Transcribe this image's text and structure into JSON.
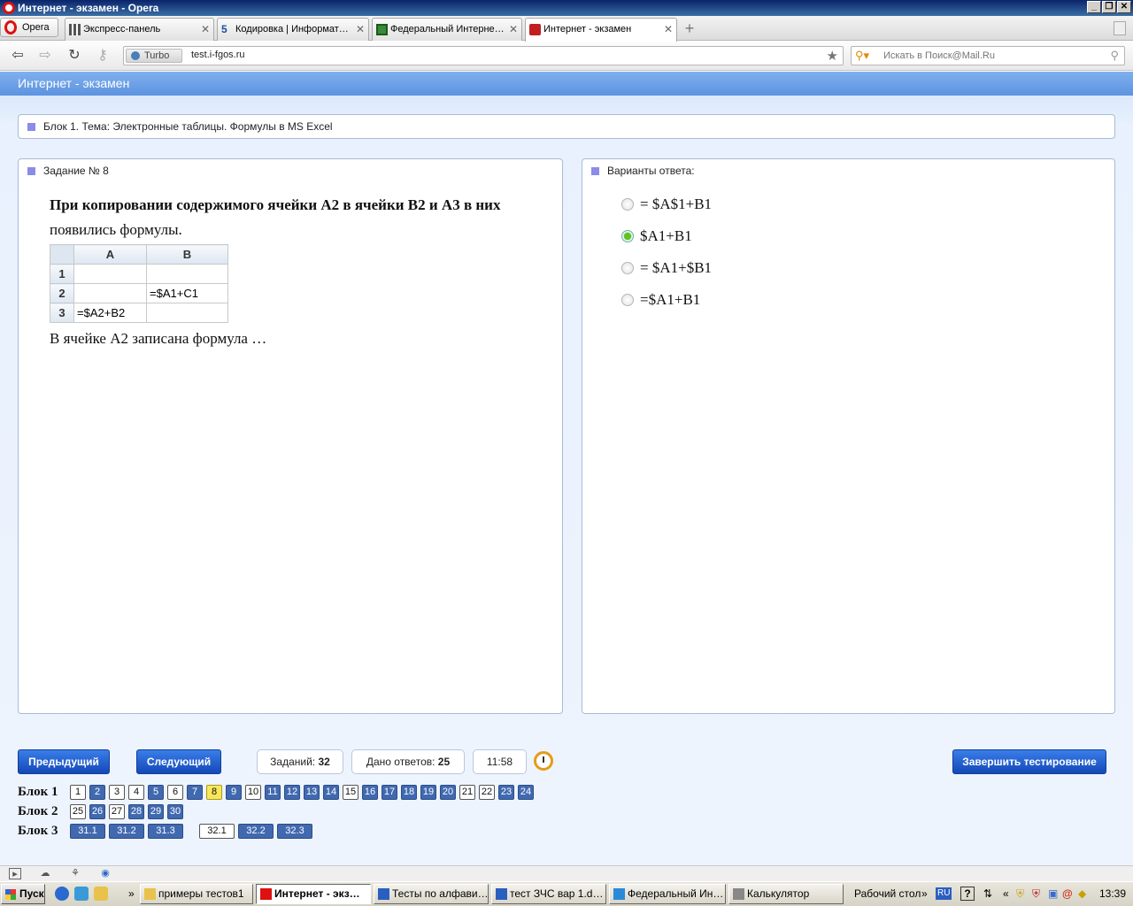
{
  "window": {
    "title": "Интернет - экзамен - Opera"
  },
  "tabs": {
    "opera_menu": "Opera",
    "items": [
      {
        "label": "Экспресс-панель"
      },
      {
        "label": "Кодировка | Информат…"
      },
      {
        "label": "Федеральный Интерне…"
      },
      {
        "label": "Интернет - экзамен"
      }
    ]
  },
  "nav": {
    "turbo_label": "Turbo",
    "url": "test.i-fgos.ru",
    "search_placeholder": "Искать в Поиск@Mail.Ru"
  },
  "page": {
    "header": "Интернет - экзамен",
    "block_title": "Блок 1. Тема: Электронные таблицы. Формулы в MS Excel",
    "task": {
      "title": "Задание № 8",
      "text_line1": "При копировании содержимого ячейки A2 в ячейки B2 и A3 в них",
      "text_line2": "появились формулы.",
      "table": {
        "columns": [
          "A",
          "B"
        ],
        "rows": [
          {
            "num": "1",
            "a": "",
            "b": ""
          },
          {
            "num": "2",
            "a": "",
            "b": "=$A1+C1"
          },
          {
            "num": "3",
            "a": "=$A2+B2",
            "b": ""
          }
        ]
      },
      "text_after": "В ячейке A2 записана формула …"
    },
    "answers": {
      "title": "Варианты ответа:",
      "options": [
        {
          "label": "= $A$1+B1",
          "selected": false
        },
        {
          "label": "$A1+B1",
          "selected": true
        },
        {
          "label": "= $A1+$B1",
          "selected": false
        },
        {
          "label": "=$A1+B1",
          "selected": false
        }
      ]
    },
    "controls": {
      "prev": "Предыдущий",
      "next": "Следующий",
      "tasks_label": "Заданий:",
      "tasks_value": "32",
      "answers_label": "Дано ответов:",
      "answers_value": "25",
      "timer": "11:58",
      "finish": "Завершить тестирование"
    },
    "blocks": [
      {
        "label": "Блок 1",
        "items": [
          {
            "n": "1",
            "s": "w"
          },
          {
            "n": "2",
            "s": "b"
          },
          {
            "n": "3",
            "s": "w"
          },
          {
            "n": "4",
            "s": "w"
          },
          {
            "n": "5",
            "s": "b"
          },
          {
            "n": "6",
            "s": "w"
          },
          {
            "n": "7",
            "s": "b"
          },
          {
            "n": "8",
            "s": "y"
          },
          {
            "n": "9",
            "s": "b"
          },
          {
            "n": "10",
            "s": "w"
          },
          {
            "n": "11",
            "s": "b"
          },
          {
            "n": "12",
            "s": "b"
          },
          {
            "n": "13",
            "s": "b"
          },
          {
            "n": "14",
            "s": "b"
          },
          {
            "n": "15",
            "s": "w"
          },
          {
            "n": "16",
            "s": "b"
          },
          {
            "n": "17",
            "s": "b"
          },
          {
            "n": "18",
            "s": "b"
          },
          {
            "n": "19",
            "s": "b"
          },
          {
            "n": "20",
            "s": "b"
          },
          {
            "n": "21",
            "s": "w"
          },
          {
            "n": "22",
            "s": "w"
          },
          {
            "n": "23",
            "s": "b"
          },
          {
            "n": "24",
            "s": "b"
          }
        ]
      },
      {
        "label": "Блок 2",
        "items": [
          {
            "n": "25",
            "s": "w"
          },
          {
            "n": "26",
            "s": "b"
          },
          {
            "n": "27",
            "s": "w"
          },
          {
            "n": "28",
            "s": "b"
          },
          {
            "n": "29",
            "s": "b"
          },
          {
            "n": "30",
            "s": "b"
          }
        ]
      },
      {
        "label": "Блок 3",
        "items": [
          {
            "n": "31.1",
            "s": "b"
          },
          {
            "n": "31.2",
            "s": "b"
          },
          {
            "n": "31.3",
            "s": "b"
          },
          {
            "n": "32.1",
            "s": "w"
          },
          {
            "n": "32.2",
            "s": "b"
          },
          {
            "n": "32.3",
            "s": "b"
          }
        ]
      }
    ]
  },
  "taskbar": {
    "start": "Пуск",
    "windows": [
      {
        "label": "примеры тестов1",
        "icon": "folder-icon"
      },
      {
        "label": "Интернет - экз…",
        "icon": "opera-icon",
        "active": true
      },
      {
        "label": "Тесты по алфави…",
        "icon": "word-icon"
      },
      {
        "label": "тест ЗЧС вар 1.d…",
        "icon": "word-icon"
      },
      {
        "label": "Федеральный Ин…",
        "icon": "ie-icon"
      },
      {
        "label": "Калькулятор",
        "icon": "calculator-icon"
      }
    ],
    "desktop": "Рабочий стол",
    "lang": "RU",
    "clock": "13:39"
  },
  "colors": {
    "accent": "#1e5ad0",
    "current_question": "#f8e75a",
    "answered": "#4169b0"
  }
}
